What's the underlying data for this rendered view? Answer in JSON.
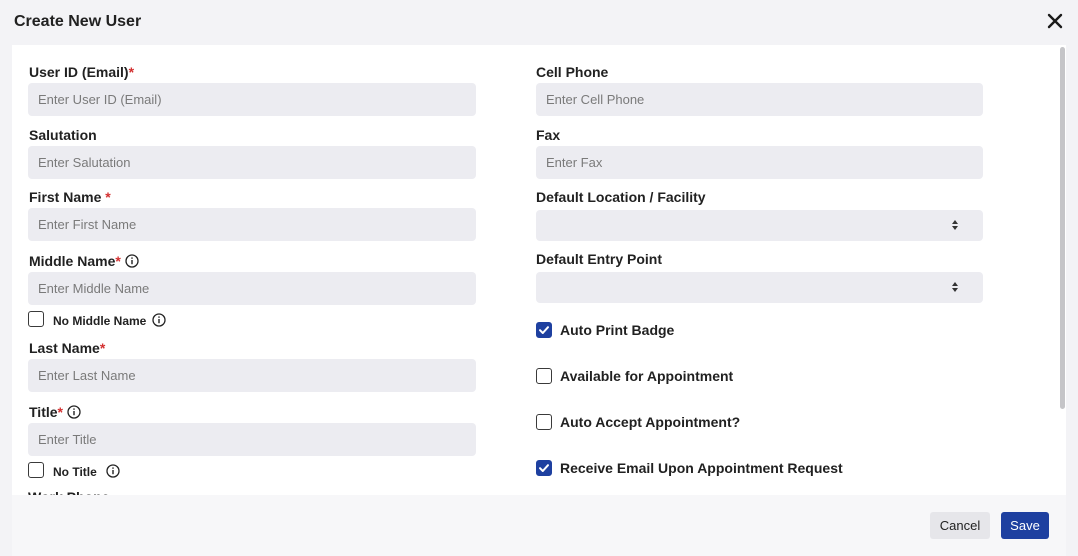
{
  "dialog": {
    "title": "Create New User"
  },
  "form": {
    "user_id": {
      "label": "User ID (Email)",
      "required": "*",
      "placeholder": "Enter User ID (Email)"
    },
    "salutation": {
      "label": "Salutation",
      "placeholder": "Enter Salutation"
    },
    "first_name": {
      "label": "First Name",
      "required": "*",
      "placeholder": "Enter First Name"
    },
    "middle_name": {
      "label": "Middle Name",
      "required": "*",
      "placeholder": "Enter Middle Name"
    },
    "no_middle_name": {
      "label": "No Middle Name",
      "checked": false
    },
    "last_name": {
      "label": "Last Name",
      "required": "*",
      "placeholder": "Enter Last Name"
    },
    "title": {
      "label": "Title",
      "required": "*",
      "placeholder": "Enter Title"
    },
    "no_title": {
      "label": "No Title",
      "checked": false
    },
    "work_phone": {
      "label": "Work Phone"
    },
    "cell_phone": {
      "label": "Cell Phone",
      "placeholder": "Enter Cell Phone"
    },
    "fax": {
      "label": "Fax",
      "placeholder": "Enter Fax"
    },
    "default_location": {
      "label": "Default Location / Facility",
      "value": ""
    },
    "default_entry_point": {
      "label": "Default Entry Point",
      "value": ""
    },
    "auto_print_badge": {
      "label": "Auto Print Badge",
      "checked": true
    },
    "available_for_appointment": {
      "label": "Available for Appointment",
      "checked": false
    },
    "auto_accept_appointment": {
      "label": "Auto Accept Appointment?",
      "checked": false
    },
    "receive_email": {
      "label": "Receive Email Upon Appointment Request",
      "checked": true
    }
  },
  "footer": {
    "cancel_label": "Cancel",
    "save_label": "Save"
  },
  "colors": {
    "primary": "#1e40a0",
    "required": "#d32f2f",
    "input_bg": "#ececf1"
  },
  "icons": {
    "close": "close-icon",
    "info": "info-icon",
    "select_arrows": "sort-arrows-icon",
    "check": "check-icon"
  }
}
